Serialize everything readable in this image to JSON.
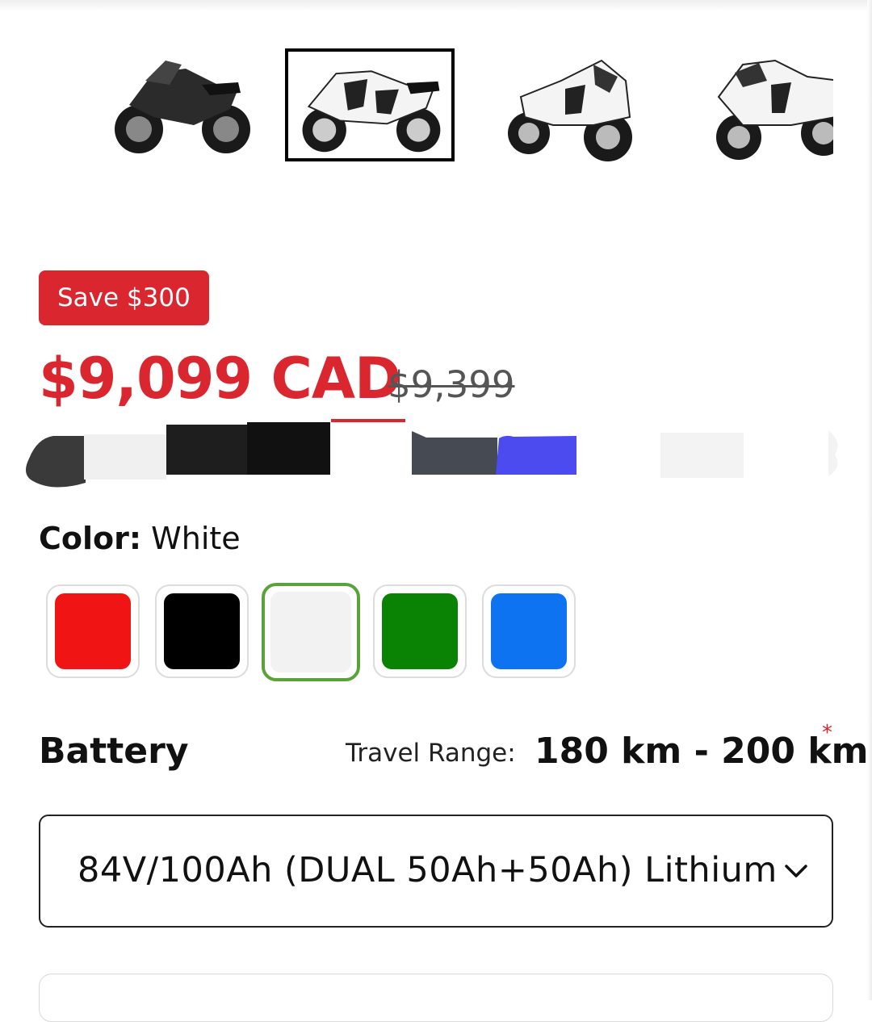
{
  "gallery": {
    "thumbnails": [
      {
        "alt": "black motorcycle",
        "color": "#2b2b2b",
        "selected": false
      },
      {
        "alt": "white motorcycle side",
        "color": "#f4f4f4",
        "selected": true
      },
      {
        "alt": "white motorcycle front",
        "color": "#f4f4f4",
        "selected": false
      },
      {
        "alt": "white motorcycle angle",
        "color": "#f4f4f4",
        "selected": false
      }
    ]
  },
  "pricing": {
    "badge": "Save $300",
    "price": "$9,099 CAD",
    "compare_price": "$9,399",
    "accent_color": "#d9262f"
  },
  "color_option": {
    "label": "Color:",
    "selected_value": "White",
    "swatches": [
      {
        "name": "Red",
        "hex": "#f01414"
      },
      {
        "name": "Black",
        "hex": "#000000"
      },
      {
        "name": "White",
        "hex": "#f2f2f2",
        "selected": true
      },
      {
        "name": "Green",
        "hex": "#0a8203"
      },
      {
        "name": "Blue",
        "hex": "#0d73f0"
      }
    ],
    "selected_border_color": "#5aa33b"
  },
  "battery": {
    "title": "Battery",
    "range_label": "Travel Range:",
    "range_value": "180 km - 200 km",
    "required_mark": "*",
    "selected_option": "84V/100Ah (DUAL 50Ah+50Ah) Lithium",
    "dropdown_icon": "chevron-down-icon"
  }
}
